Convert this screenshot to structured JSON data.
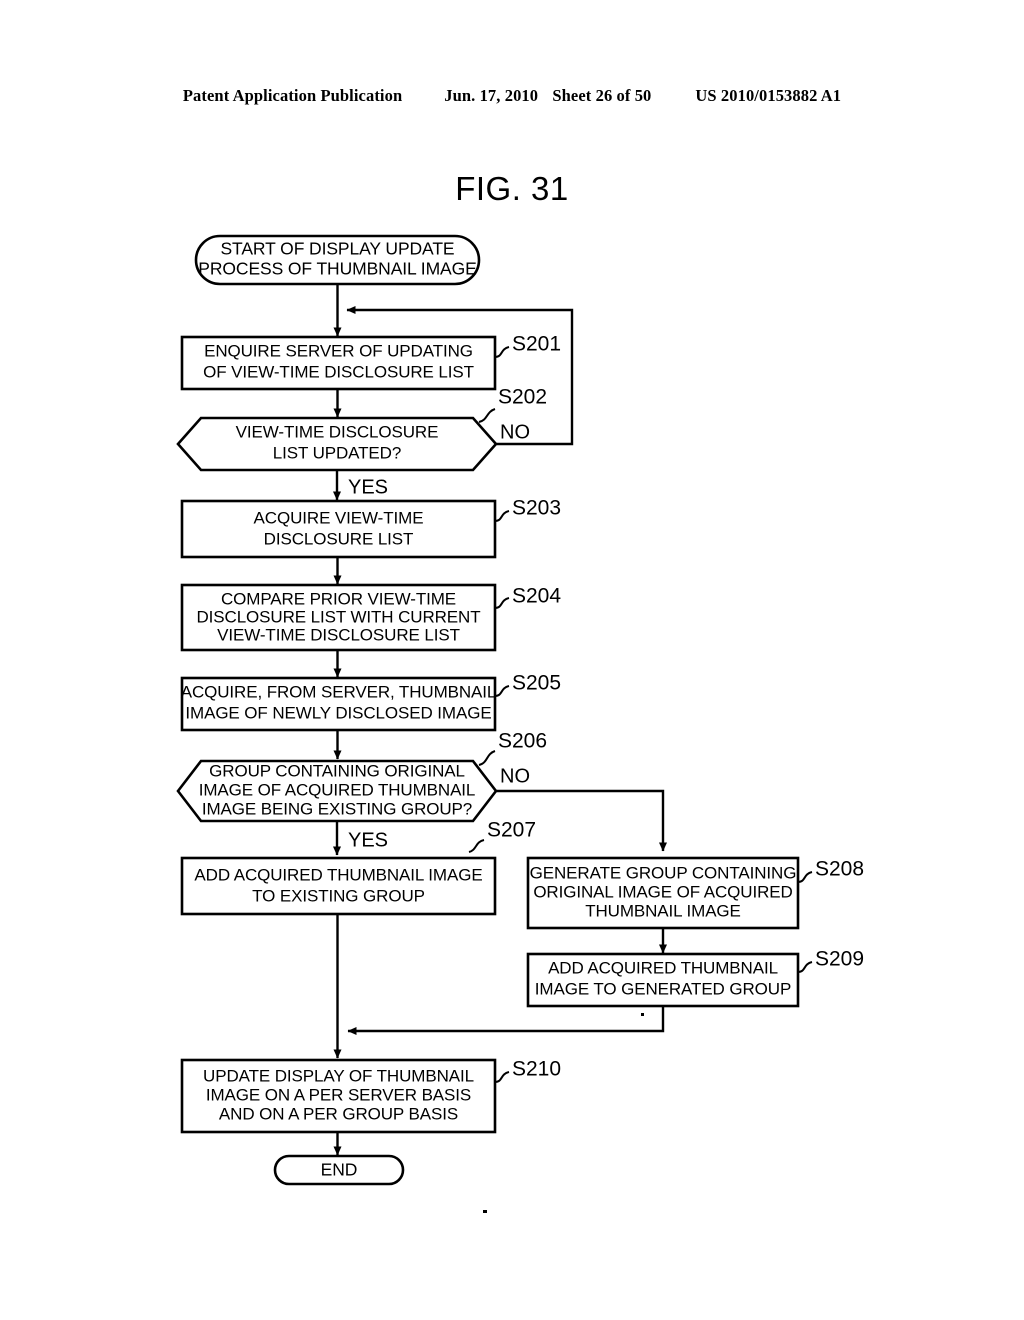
{
  "header": {
    "publication": "Patent Application Publication",
    "date": "Jun. 17, 2010",
    "sheet": "Sheet 26 of 50",
    "doc_number": "US 2010/0153882 A1"
  },
  "figure": {
    "title": "FIG. 31"
  },
  "flowchart": {
    "start": {
      "id": "start",
      "shape": "terminator",
      "lines": [
        "START OF DISPLAY UPDATE",
        "PROCESS OF THUMBNAIL IMAGE"
      ]
    },
    "end": {
      "id": "end",
      "shape": "terminator",
      "lines": [
        "END"
      ]
    },
    "steps": [
      {
        "id": "s201",
        "ref": "S201",
        "shape": "process",
        "lines": [
          "ENQUIRE SERVER OF UPDATING",
          "OF VIEW-TIME DISCLOSURE LIST"
        ]
      },
      {
        "id": "s202",
        "ref": "S202",
        "shape": "decision",
        "lines": [
          "VIEW-TIME DISCLOSURE",
          "LIST UPDATED?"
        ],
        "branch_no": "NO",
        "branch_yes": "YES"
      },
      {
        "id": "s203",
        "ref": "S203",
        "shape": "process",
        "lines": [
          "ACQUIRE VIEW-TIME",
          "DISCLOSURE LIST"
        ]
      },
      {
        "id": "s204",
        "ref": "S204",
        "shape": "process",
        "lines": [
          "COMPARE PRIOR VIEW-TIME",
          "DISCLOSURE LIST WITH CURRENT",
          "VIEW-TIME DISCLOSURE LIST"
        ]
      },
      {
        "id": "s205",
        "ref": "S205",
        "shape": "process",
        "lines": [
          "ACQUIRE, FROM SERVER, THUMBNAIL",
          "IMAGE OF NEWLY DISCLOSED IMAGE"
        ]
      },
      {
        "id": "s206",
        "ref": "S206",
        "shape": "decision",
        "lines": [
          "GROUP CONTAINING ORIGINAL",
          "IMAGE OF ACQUIRED THUMBNAIL",
          "IMAGE BEING EXISTING GROUP?"
        ],
        "branch_no": "NO",
        "branch_yes": "YES"
      },
      {
        "id": "s207",
        "ref": "S207",
        "shape": "process",
        "lines": [
          "ADD ACQUIRED THUMBNAIL IMAGE",
          "TO EXISTING GROUP"
        ]
      },
      {
        "id": "s208",
        "ref": "S208",
        "shape": "process",
        "lines": [
          "GENERATE GROUP CONTAINING",
          "ORIGINAL IMAGE OF ACQUIRED",
          "THUMBNAIL IMAGE"
        ]
      },
      {
        "id": "s209",
        "ref": "S209",
        "shape": "process",
        "lines": [
          "ADD ACQUIRED THUMBNAIL",
          "IMAGE TO GENERATED GROUP"
        ]
      },
      {
        "id": "s210",
        "ref": "S210",
        "shape": "process",
        "lines": [
          "UPDATE DISPLAY OF THUMBNAIL",
          "IMAGE ON A PER SERVER BASIS",
          "AND ON A PER GROUP BASIS"
        ]
      }
    ]
  },
  "colors": {
    "ink": "#000000",
    "paper": "#ffffff"
  }
}
